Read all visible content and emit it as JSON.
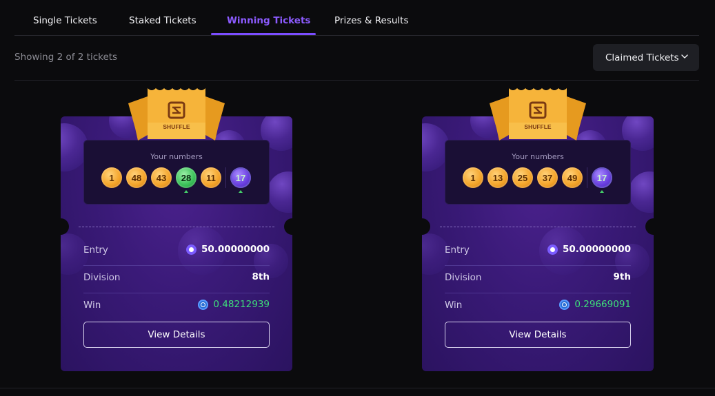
{
  "tabs": [
    {
      "label": "Single Tickets",
      "active": false
    },
    {
      "label": "Staked Tickets",
      "active": false
    },
    {
      "label": "Winning Tickets",
      "active": true
    },
    {
      "label": "Prizes & Results",
      "active": false
    }
  ],
  "showing_text": "Showing 2 of 2 tickets",
  "filter": {
    "selected": "Claimed Tickets"
  },
  "brand": {
    "logo_text": "SHUFFLE"
  },
  "colors": {
    "accent": "#7b4dff",
    "win_green": "#3ee07a",
    "card_purple": "#3a1a78",
    "gold": "#f4a52b"
  },
  "tickets": [
    {
      "your_numbers_label": "Your numbers",
      "numbers": [
        "1",
        "48",
        "43",
        "28",
        "11"
      ],
      "matched": [
        false,
        false,
        false,
        true,
        false
      ],
      "bonus": "17",
      "bonus_matched": true,
      "entry_label": "Entry",
      "entry_value": "50.00000000",
      "division_label": "Division",
      "division_value": "8th",
      "win_label": "Win",
      "win_value": "0.48212939",
      "button_label": "View Details"
    },
    {
      "your_numbers_label": "Your numbers",
      "numbers": [
        "1",
        "13",
        "25",
        "37",
        "49"
      ],
      "matched": [
        false,
        false,
        false,
        false,
        false
      ],
      "bonus": "17",
      "bonus_matched": true,
      "entry_label": "Entry",
      "entry_value": "50.00000000",
      "division_label": "Division",
      "division_value": "9th",
      "win_label": "Win",
      "win_value": "0.29669091",
      "button_label": "View Details"
    }
  ]
}
